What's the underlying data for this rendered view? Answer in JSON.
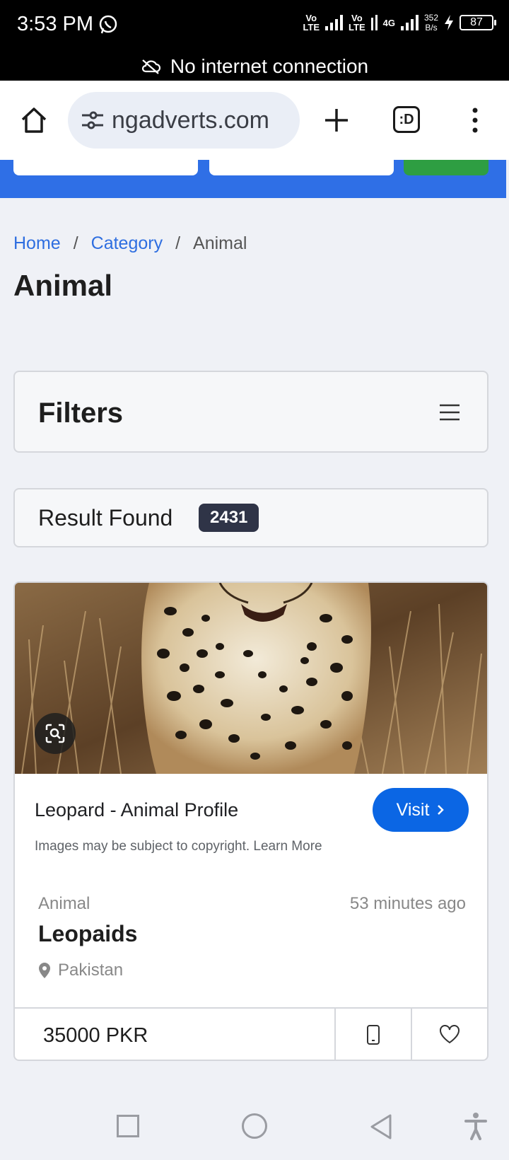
{
  "status_bar": {
    "time": "3:53 PM",
    "net1": "Vo\nLTE",
    "net2": "Vo\nLTE",
    "net3": "4G",
    "speed_value": "352",
    "speed_unit": "B/s",
    "battery": "87"
  },
  "offline_banner": {
    "text": "No internet connection",
    "icon": "cloud-off-icon"
  },
  "browser": {
    "url": "ngadverts.com",
    "tabs_label": ":D",
    "icons": [
      "home-icon",
      "site-settings-icon",
      "new-tab-icon",
      "tab-switcher-icon",
      "overflow-menu-icon"
    ]
  },
  "breadcrumb": {
    "home": "Home",
    "category": "Category",
    "current": "Animal",
    "separator": "/"
  },
  "page_title": "Animal",
  "filters": {
    "title": "Filters",
    "icon": "hamburger-icon"
  },
  "result": {
    "label": "Result Found",
    "count": "2431"
  },
  "listing": {
    "source_title": "Leopard - Animal Profile",
    "visit_label": "Visit",
    "copyright_note": "Images may be subject to copyright. Learn More",
    "category": "Animal",
    "posted": "53 minutes ago",
    "title": "Leopaids",
    "location": "Pakistan",
    "price": "35000 PKR"
  },
  "colors": {
    "accent_blue": "#2f6fe6",
    "link_blue": "#2e6ee0",
    "visit_blue": "#0b66e4",
    "search_green": "#2e9e42",
    "badge_dark": "#2f3447"
  }
}
